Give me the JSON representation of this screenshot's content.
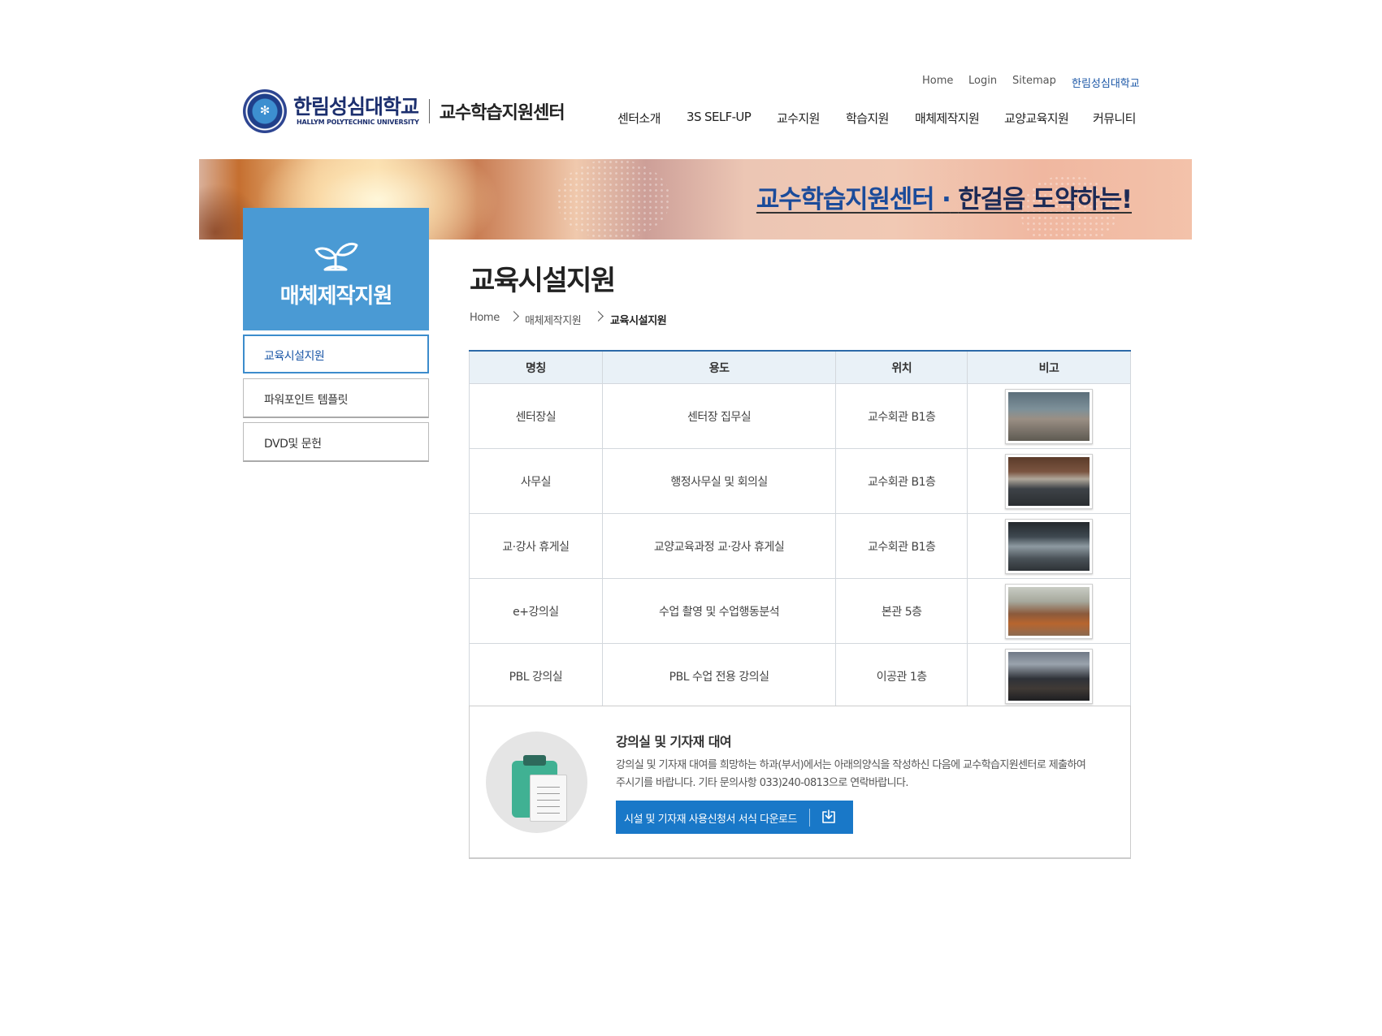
{
  "util_nav": [
    "Home",
    "Login",
    "Sitemap",
    "한림성심대학교"
  ],
  "logo": {
    "korean": "한림성심대학교",
    "english": "HALLYM POLYTECHNIC UNIVERSITY",
    "center": "교수학습지원센터"
  },
  "gnb": [
    "센터소개",
    "3S SELF-UP",
    "교수지원",
    "학습지원",
    "매체제작지원",
    "교양교육지원",
    "커뮤니티"
  ],
  "banner": {
    "slogan_part1": "교수학습지원센터",
    "slogan_dot": "·",
    "slogan_part2": "한걸음 도약하는!"
  },
  "sidebar": {
    "title": "매체제작지원",
    "items": [
      {
        "label": "교육시설지원",
        "active": true
      },
      {
        "label": "파워포인트 템플릿",
        "active": false
      },
      {
        "label": "DVD및 문헌",
        "active": false
      }
    ]
  },
  "page": {
    "title": "교육시설지원",
    "breadcrumb": [
      "Home",
      "매체제작지원",
      "교육시설지원"
    ]
  },
  "table": {
    "headers": [
      "명칭",
      "용도",
      "위치",
      "비고"
    ],
    "rows": [
      {
        "name": "센터장실",
        "use": "센터장 집무실",
        "location": "교수회관 B1층",
        "photo": "office-photo"
      },
      {
        "name": "사무실",
        "use": "행정사무실 및 회의실",
        "location": "교수회관 B1층",
        "photo": "meeting-room-photo"
      },
      {
        "name": "교·강사 휴게실",
        "use": "교양교육과정 교·강사 휴게실",
        "location": "교수회관 B1층",
        "photo": "lounge-photo"
      },
      {
        "name": "e+강의실",
        "use": "수업 촬영 및 수업행동분석",
        "location": "본관 5층",
        "photo": "classroom-photo"
      },
      {
        "name": "PBL 강의실",
        "use": "PBL 수업 전용 강의실",
        "location": "이공관 1층",
        "photo": "pbl-room-photo"
      }
    ]
  },
  "rental": {
    "title": "강의실 및 기자재 대여",
    "desc_line1": "강의실 및 기자재 대여를 희망하는 하과(부서)에서는 아래의양식을 작성하신 다음에 교수학습지원센터로 제출하여",
    "desc_line2": "주시기를 바랍니다. 기타 문의사항 033)240-0813으로 연락바랍니다.",
    "button": "시설 및 기자재 사용신청서 서식 다운로드",
    "icon": "download-icon"
  },
  "colors": {
    "accent": "#4a9ad4",
    "brand_navy": "#1c2f6e",
    "button": "#1978c8"
  }
}
